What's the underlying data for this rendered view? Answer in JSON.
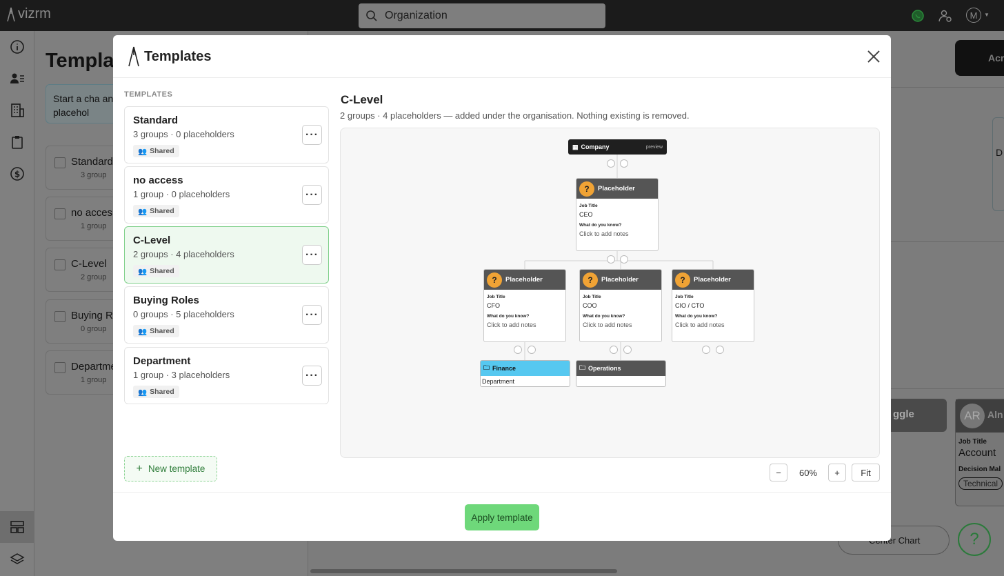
{
  "app": {
    "logo_text": "vizrm",
    "search_placeholder": "Organization",
    "avatar_letter": "M"
  },
  "background": {
    "title": "Templa",
    "info": "Start a cha and placehol",
    "cards": [
      {
        "name": "Standard",
        "sub": "3 group"
      },
      {
        "name": "no acces",
        "sub": "1 group"
      },
      {
        "name": "C-Level",
        "sub": "2 group"
      },
      {
        "name": "Buying Ro",
        "sub": "0 group"
      },
      {
        "name": "Departme",
        "sub": "1 group"
      }
    ],
    "right_text": "Acr",
    "right_d": "D",
    "right_person_initials": "AR",
    "right_person_name": "Aln",
    "right_job_label": "Job Title",
    "right_job_value": "Account",
    "right_decision": "Decision Mal",
    "right_tag": "Technical",
    "right_toggle": "ggle",
    "center_chart": "Center Chart"
  },
  "modal": {
    "title": "Templates",
    "section_label": "TEMPLATES",
    "new_template_label": "New template",
    "apply_label": "Apply template"
  },
  "templates": [
    {
      "name": "Standard",
      "counts": "3 groups · 0 placeholders",
      "badge": "Shared"
    },
    {
      "name": "no access",
      "counts": "1 group · 0 placeholders",
      "badge": "Shared"
    },
    {
      "name": "C-Level",
      "counts": "2 groups · 4 placeholders",
      "badge": "Shared"
    },
    {
      "name": "Buying Roles",
      "counts": "0 groups · 5 placeholders",
      "badge": "Shared"
    },
    {
      "name": "Department",
      "counts": "1 group · 3 placeholders",
      "badge": "Shared"
    }
  ],
  "preview": {
    "title": "C-Level",
    "description": "2 groups · 4 placeholders — added under the organisation. Nothing existing is removed.",
    "company_label": "Company",
    "preview_tag": "preview",
    "placeholders": [
      {
        "name": "Placeholder",
        "job_label": "Job Title",
        "job": "CEO",
        "notes_label": "What do you know?",
        "notes": "Click to add notes"
      },
      {
        "name": "Placeholder",
        "job_label": "Job Title",
        "job": "CFO",
        "notes_label": "What do you know?",
        "notes": "Click to add notes"
      },
      {
        "name": "Placeholder",
        "job_label": "Job Title",
        "job": "COO",
        "notes_label": "What do you know?",
        "notes": "Click to add notes"
      },
      {
        "name": "Placeholder",
        "job_label": "Job Title",
        "job": "CIO / CTO",
        "notes_label": "What do you know?",
        "notes": "Click to add notes"
      }
    ],
    "groups": [
      {
        "name": "Finance",
        "sub": "Department",
        "color": "#56c8f0"
      },
      {
        "name": "Operations",
        "sub": "",
        "color": "#555555"
      }
    ],
    "zoom": "60%",
    "fit_label": "Fit",
    "zoom_out": "−",
    "zoom_in": "+"
  },
  "colors": {
    "accent": "#6ed87a",
    "selected_bg": "#eef9ef",
    "placeholder_badge": "#f0a335"
  }
}
